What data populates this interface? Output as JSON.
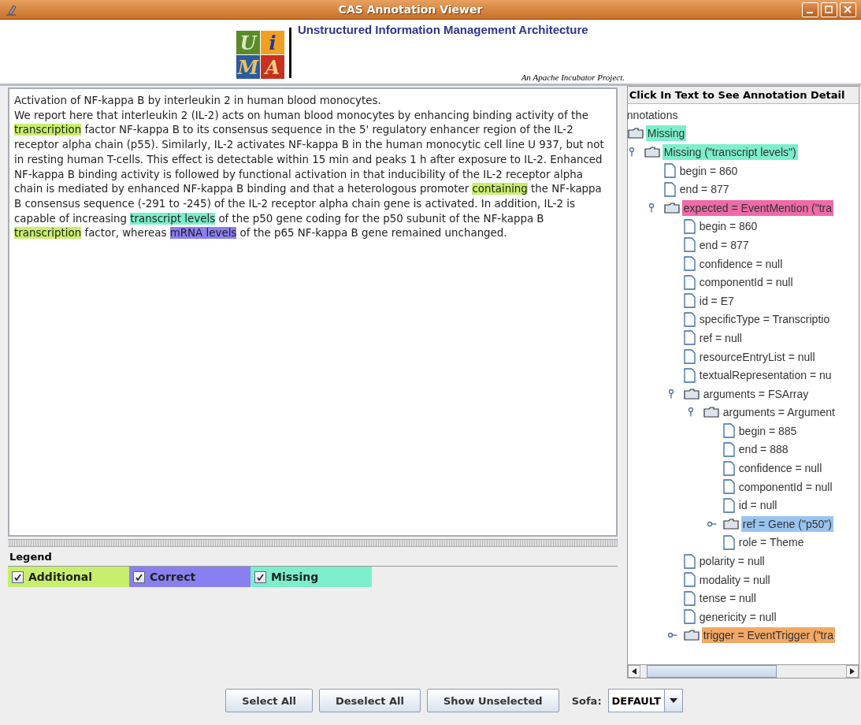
{
  "window": {
    "title": "CAS Annotation Viewer"
  },
  "header": {
    "logo_letters": [
      "U",
      "i",
      "M",
      "A"
    ],
    "title": "Unstructured Information Management Architecture",
    "tagline": "An Apache Incubator Project."
  },
  "document": {
    "paragraphs": [
      [
        {
          "text": "Activation of NF-kappa B by interleukin 2 in human blood monocytes."
        }
      ],
      [
        {
          "text": "We report here that interleukin 2 (IL-2) acts on human blood monocytes by enhancing binding activity of the "
        },
        {
          "text": "transcription",
          "color": "#c8ee6e"
        },
        {
          "text": " factor NF-kappa B to its consensus sequence in the 5' regulatory enhancer region of the IL-2 receptor alpha chain (p55). Similarly, IL-2 activates NF-kappa B in the human monocytic cell line U 937, but not in resting human T-cells. This effect is detectable within 15 min and peaks 1 h after exposure to IL-2. Enhanced NF-kappa B binding activity is followed by functional activation in that inducibility of the IL-2 receptor alpha chain is mediated by enhanced NF-kappa B binding and that a heterologous promoter "
        },
        {
          "text": "containing",
          "color": "#c8ee6e"
        },
        {
          "text": " the NF-kappa B consensus sequence (-291 to -245) of the IL-2 receptor alpha chain gene is activated. In addition, IL-2 is capable of increasing "
        },
        {
          "text": "transcript levels",
          "color": "#7ceecb"
        },
        {
          "text": " of the p50 gene coding for the p50 subunit of the NF-kappa B "
        },
        {
          "text": "transcription",
          "color": "#c8ee6e"
        },
        {
          "text": " factor, whereas "
        },
        {
          "text": "mRNA levels",
          "color": "#8a7ff0"
        },
        {
          "text": " of the p65 NF-kappa B gene remained unchanged."
        }
      ]
    ]
  },
  "legend": {
    "title": "Legend",
    "items": [
      {
        "label": "Additional",
        "checked": true,
        "color": "#c8ee6e"
      },
      {
        "label": "Correct",
        "checked": true,
        "color": "#8a7ff0"
      },
      {
        "label": "Missing",
        "checked": true,
        "color": "#7ceecb"
      }
    ]
  },
  "tree_panel": {
    "title": "Click In Text to See Annotation Detail",
    "root_label": "nnotations",
    "nodes": [
      {
        "label": "Missing",
        "kind": "folder",
        "selected": false,
        "color": "#7ceecb",
        "children": [
          {
            "label": "Missing (\"transcript levels\")",
            "kind": "folder",
            "expanded": true,
            "selected": false,
            "color": "#7ceecb",
            "children": [
              {
                "label": "begin = 860",
                "kind": "leaf",
                "selected": false
              },
              {
                "label": "end = 877",
                "kind": "leaf",
                "selected": false
              },
              {
                "label": "expected = EventMention (\"tra",
                "kind": "folder",
                "expanded": true,
                "selected": false,
                "color": "#ee6aa8",
                "children": [
                  {
                    "label": "begin = 860",
                    "kind": "leaf",
                    "selected": false
                  },
                  {
                    "label": "end = 877",
                    "kind": "leaf",
                    "selected": false
                  },
                  {
                    "label": "confidence = null",
                    "kind": "leaf",
                    "selected": false
                  },
                  {
                    "label": "componentId = null",
                    "kind": "leaf",
                    "selected": false
                  },
                  {
                    "label": "id = E7",
                    "kind": "leaf",
                    "selected": false
                  },
                  {
                    "label": "specificType = Transcriptio",
                    "kind": "leaf",
                    "selected": false
                  },
                  {
                    "label": "ref = null",
                    "kind": "leaf",
                    "selected": false
                  },
                  {
                    "label": "resourceEntryList = null",
                    "kind": "leaf",
                    "selected": false
                  },
                  {
                    "label": "textualRepresentation = nu",
                    "kind": "leaf",
                    "selected": false
                  },
                  {
                    "label": "arguments = FSArray",
                    "kind": "folder",
                    "expanded": true,
                    "selected": false,
                    "children": [
                      {
                        "label": "arguments = Argument",
                        "kind": "folder",
                        "expanded": true,
                        "selected": false,
                        "children": [
                          {
                            "label": "begin = 885",
                            "kind": "leaf",
                            "selected": false
                          },
                          {
                            "label": "end = 888",
                            "kind": "leaf",
                            "selected": false
                          },
                          {
                            "label": "confidence = null",
                            "kind": "leaf",
                            "selected": false
                          },
                          {
                            "label": "componentId = null",
                            "kind": "leaf",
                            "selected": false
                          },
                          {
                            "label": "id = null",
                            "kind": "leaf",
                            "selected": false
                          },
                          {
                            "label": "ref = Gene (\"p50\")",
                            "kind": "folder",
                            "expanded": false,
                            "selected": true
                          },
                          {
                            "label": "role = Theme",
                            "kind": "leaf",
                            "selected": false
                          }
                        ]
                      }
                    ]
                  },
                  {
                    "label": "polarity = null",
                    "kind": "leaf",
                    "selected": false
                  },
                  {
                    "label": "modality = null",
                    "kind": "leaf",
                    "selected": false
                  },
                  {
                    "label": "tense = null",
                    "kind": "leaf",
                    "selected": false
                  },
                  {
                    "label": "genericity = null",
                    "kind": "leaf",
                    "selected": false
                  },
                  {
                    "label": "trigger = EventTrigger (\"tra",
                    "kind": "folder",
                    "expanded": false,
                    "selected": false,
                    "color": "#f2a865"
                  }
                ]
              }
            ]
          }
        ]
      }
    ]
  },
  "buttons": [
    "Select All",
    "Deselect All",
    "Show Unselected"
  ],
  "sofa": {
    "label": "Sofa:",
    "value": "DEFAULT"
  }
}
